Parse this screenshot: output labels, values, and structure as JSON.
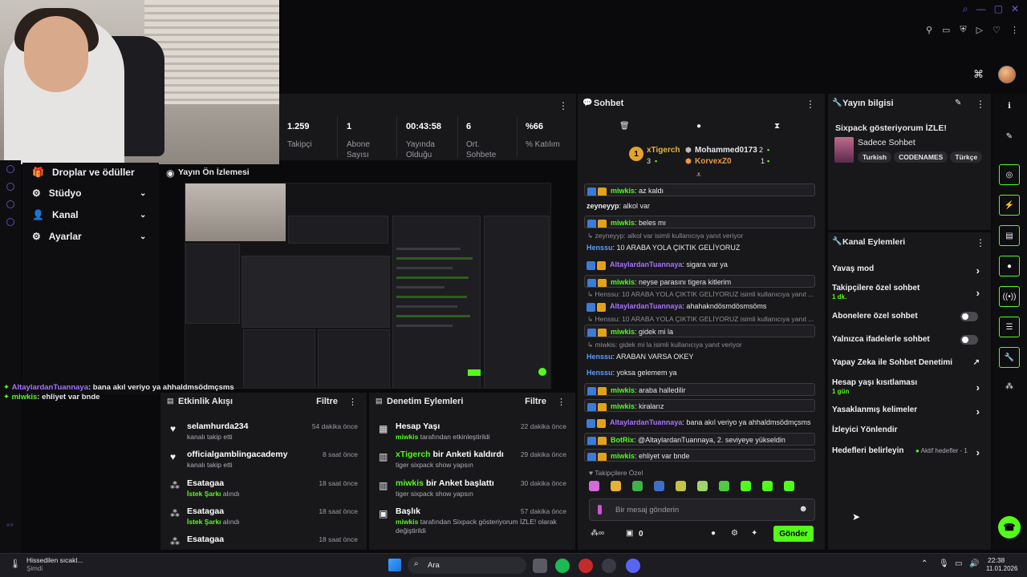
{
  "stats": [
    {
      "value": "1.259",
      "label": "Takipçi"
    },
    {
      "value": "1",
      "label": "Abone\nSayısı"
    },
    {
      "value": "00:43:58",
      "label": "Yayında\nOlduğu"
    },
    {
      "value": "6",
      "label": "Ort.\nSohbete"
    },
    {
      "value": "%66",
      "label": "% Katılım"
    }
  ],
  "leftnav": {
    "items": [
      {
        "label": "Droplar ve ödüller",
        "icon": "gift-icon"
      },
      {
        "label": "Stüdyo",
        "icon": "gear-icon"
      },
      {
        "label": "Kanal",
        "icon": "user-icon"
      },
      {
        "label": "Ayarlar",
        "icon": "settings-icon"
      }
    ]
  },
  "preview": {
    "title": "Yayın Ön İzlemesi"
  },
  "video_chat": [
    {
      "user": "AltaylardanTuannaya",
      "text": ": bana akıl veriyo ya ahhaldmsödmçsms"
    },
    {
      "user": "miwkis",
      "text": ": ehliyet var bnde"
    }
  ],
  "activity": {
    "title": "Etkinlik Akışı",
    "filter": "Filtre",
    "items": [
      {
        "name": "selamhurda234",
        "desc": "kanalı takip etti",
        "time": "54 dakika önce",
        "icon": "heart-icon"
      },
      {
        "name": "officialgamblingacademy",
        "desc": "kanalı takip etti",
        "time": "8 saat önce",
        "icon": "heart-icon"
      },
      {
        "name": "Esatagaa",
        "desc_green": "İstek Şarkı",
        "desc": " alındı",
        "time": "18 saat önce",
        "icon": "points-icon"
      },
      {
        "name": "Esatagaa",
        "desc_green": "İstek Şarkı",
        "desc": " alındı",
        "time": "18 saat önce",
        "icon": "points-icon"
      },
      {
        "name": "Esatagaa",
        "desc": "",
        "time": "18 saat önce",
        "icon": "points-icon"
      }
    ]
  },
  "moderation": {
    "title": "Denetim Eylemleri",
    "filter": "Filtre",
    "items": [
      {
        "title": "Hesap Yaşı",
        "user": "miwkis",
        "desc": " tarafından etkinleştirildi",
        "time": "22 dakika önce",
        "icon": "calendar-icon"
      },
      {
        "title_green": "xTigerch",
        "title": " bir Anketi kaldırdı",
        "desc": "tiger sixpack show yapsın",
        "time": "29 dakika önce",
        "icon": "poll-icon"
      },
      {
        "title_green": "miwkis",
        "title": " bir Anket başlattı",
        "desc": "tiger sixpack show yapsın",
        "time": "30 dakika önce",
        "icon": "poll-icon"
      },
      {
        "title": "Başlık",
        "user": "miwkis",
        "desc": " tarafından Sixpack gösteriyorum İZLE! olarak",
        "desc2": "değiştirildi",
        "time": "57 dakika önce",
        "icon": "title-icon"
      }
    ]
  },
  "chat": {
    "title": "Sohbet",
    "leaderboard": {
      "rank1": "1",
      "top_user": "xTigerch",
      "top_count": "3",
      "users": [
        {
          "name": "Mohammed0173",
          "count": "2"
        },
        {
          "name": "KorvexZ0",
          "count": "1"
        }
      ]
    },
    "messages": [
      {
        "user": "miwkis",
        "color": "#53fc18",
        "text": ": az kaldı",
        "hl": true,
        "badges": true
      },
      {
        "user": "zeyneyyp",
        "color": "#efeff1",
        "text": ": alkol var",
        "hl": false,
        "badges": false
      },
      {
        "user": "miwkis",
        "color": "#53fc18",
        "text": ": beles mı",
        "hl": true,
        "badges": true
      },
      {
        "reply": "↳ zeyneyyp: alkol var isimli kullanıcıya yanıt veriyor"
      },
      {
        "user": "Henssu",
        "color": "#5b9bff",
        "text": ": 10 ARABA YOLA ÇIKTIK GELİYORUZ",
        "hl": false,
        "badges": false
      },
      {
        "user": "AltaylardanTuannaya",
        "color": "#a970ff",
        "text": ": sigara var ya",
        "hl": false,
        "badges": true
      },
      {
        "user": "miwkis",
        "color": "#53fc18",
        "text": ": neyse parasını tigera kitlerim",
        "hl": true,
        "badges": true
      },
      {
        "reply": "↳ Henssu: 10 ARABA YOLA ÇIKTIK GELİYORUZ isimli kullanıcıya yanıt ..."
      },
      {
        "user": "AltaylardanTuannaya",
        "color": "#a970ff",
        "text": ": ahahakndösmdösmsöms",
        "hl": false,
        "badges": true
      },
      {
        "reply": "↳ Henssu: 10 ARABA YOLA ÇIKTIK GELİYORUZ isimli kullanıcıya yanıt ..."
      },
      {
        "user": "miwkis",
        "color": "#53fc18",
        "text": ": gidek mi la",
        "hl": true,
        "badges": true
      },
      {
        "reply": "↳ miwkis: gidek mi la isimli kullanıcıya yanıt veriyor"
      },
      {
        "user": "Henssu",
        "color": "#5b9bff",
        "text": ": ARABAN VARSA OKEY",
        "hl": false,
        "badges": false
      },
      {
        "user": "Henssu",
        "color": "#5b9bff",
        "text": ": yoksa gelemem ya",
        "hl": false,
        "badges": false
      },
      {
        "user": "miwkis",
        "color": "#53fc18",
        "text": ": araba halledilir",
        "hl": true,
        "badges": true
      },
      {
        "user": "miwkis",
        "color": "#53fc18",
        "text": ": kiralarız",
        "hl": true,
        "badges": true
      },
      {
        "user": "AltaylardanTuannaya",
        "color": "#a970ff",
        "text": ": bana akıl veriyo ya ahhaldmsödmçsms",
        "hl": false,
        "badges": true
      },
      {
        "user": "BotRix",
        "color": "#53fc18",
        "text": ": @AltaylardanTuannaya, 2. seviyeye yükseldin",
        "hl": true,
        "badges": true
      },
      {
        "user": "miwkis",
        "color": "#53fc18",
        "text": ": ehliyet var bnde",
        "hl": true,
        "badges": true
      }
    ],
    "followers_only": "Takipçilere Özel",
    "input_placeholder": "Bir mesaj gönderin",
    "counter": "0",
    "send_label": "Gönder"
  },
  "stream_info": {
    "title": "Yayın bilgisi",
    "stream_title": "Sixpack gösteriyorum İZLE!",
    "category": "Sadece Sohbet",
    "tags": [
      "Turkish",
      "CODENAMES",
      "Türkçe"
    ]
  },
  "channel_actions": {
    "title": "Kanal Eylemleri",
    "items": [
      {
        "label": "Yavaş mod",
        "type": "chevron"
      },
      {
        "label": "Takipçilere özel sohbet",
        "sub": "1 dk.",
        "type": "chevron"
      },
      {
        "label": "Abonelere özel sohbet",
        "type": "toggle"
      },
      {
        "label": "Yalnızca ifadelerle sohbet",
        "type": "toggle"
      },
      {
        "label": "Yapay Zeka ile Sohbet Denetimi",
        "type": "external"
      },
      {
        "label": "Hesap yaşı kısıtlaması",
        "sub": "1 gün",
        "type": "chevron"
      },
      {
        "label": "Yasaklanmış kelimeler",
        "type": "chevron"
      },
      {
        "label": "İzleyici Yönlendir",
        "type": "none"
      },
      {
        "label": "Hedefleri belirleyin",
        "extra": "Aktif hedefler - 1",
        "type": "chevron"
      }
    ]
  },
  "taskbar": {
    "weather": "Hissedilen sıcakl...",
    "weather_sub": "Şimdi",
    "search": "Ara",
    "time": "22:38",
    "date": "11.01.2026"
  },
  "colors": {
    "accent": "#53fc18",
    "bg": "#0a0a0d",
    "panel": "#18181b",
    "purple": "#a970ff"
  }
}
